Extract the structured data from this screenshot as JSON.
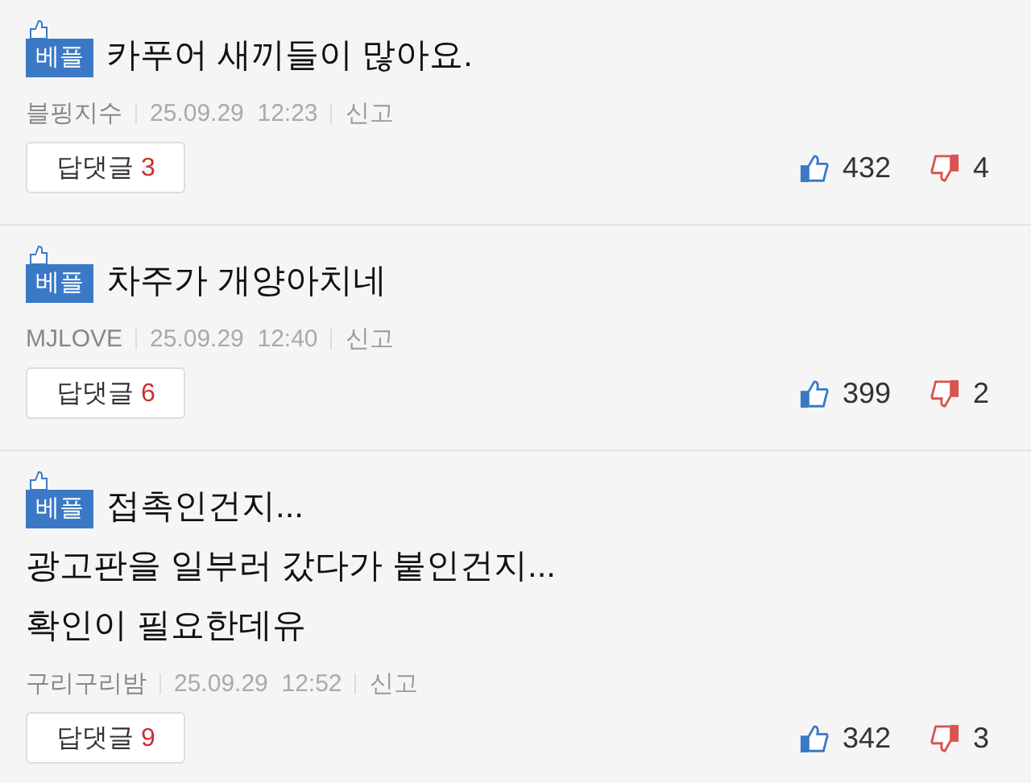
{
  "comments": [
    {
      "badge": "베플",
      "lines": [
        "카푸어 새끼들이 많아요."
      ],
      "author": "블핑지수",
      "datetime": "25.09.29  12:23",
      "report": "신고",
      "reply_label": "답댓글",
      "reply_count": "3",
      "likes": "432",
      "dislikes": "4"
    },
    {
      "badge": "베플",
      "lines": [
        "차주가 개양아치네"
      ],
      "author": "MJLOVE",
      "datetime": "25.09.29  12:40",
      "report": "신고",
      "reply_label": "답댓글",
      "reply_count": "6",
      "likes": "399",
      "dislikes": "2"
    },
    {
      "badge": "베플",
      "lines": [
        "접촉인건지...",
        "광고판을 일부러 갔다가 붙인건지...",
        "확인이 필요한데유"
      ],
      "author": "구리구리밤",
      "datetime": "25.09.29  12:52",
      "report": "신고",
      "reply_label": "답댓글",
      "reply_count": "9",
      "likes": "342",
      "dislikes": "3"
    }
  ]
}
